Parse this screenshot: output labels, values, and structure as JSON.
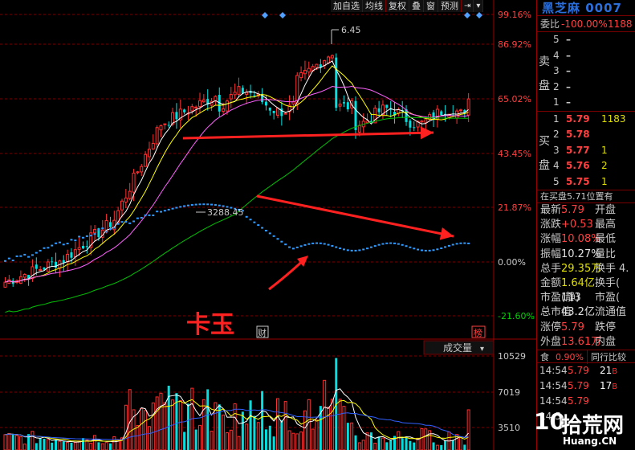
{
  "toolbar": [
    {
      "label": "加自选",
      "name": "add-watchlist-button"
    },
    {
      "label": "均线",
      "name": "moving-average-button"
    },
    {
      "label": "复权",
      "name": "adjust-button"
    },
    {
      "label": "叠",
      "name": "overlay-button"
    },
    {
      "label": "窗",
      "name": "window-button"
    },
    {
      "label": "预测",
      "name": "forecast-button"
    }
  ],
  "toolbar_icons": [
    "exit-icon",
    "dropdown-icon"
  ],
  "chart_data": {
    "type": "candlestick",
    "percent_axis": [
      "99.16%",
      "86.92%",
      "65.02%",
      "43.45%",
      "21.87%",
      "0.00%",
      "-21.60%"
    ],
    "high_marker": "6.45",
    "index_marker": "3288.45",
    "volume_label": "成交量",
    "volume_axis": [
      "10529",
      "7019",
      "3510"
    ],
    "tags": {
      "finance": "财",
      "rank": "榜"
    },
    "annotation_text": "卡玉",
    "colors": {
      "up": "#ff3030",
      "down": "#00e0e0",
      "ma5": "#ffffff",
      "ma10": "#ffff00",
      "ma20": "#ff60ff",
      "ma60": "#00c000",
      "index": "#2f9bff",
      "arrow": "#ff2020"
    }
  },
  "panel": {
    "stock_name": "黑芝麻 0007",
    "wei_label": "委比",
    "wei_bi": "-100.00%",
    "wei_cha": "1188",
    "sell_label": "卖盘",
    "buy_label": "买盘",
    "sell": [
      {
        "level": "5",
        "price": "–",
        "vol": ""
      },
      {
        "level": "4",
        "price": "–",
        "vol": ""
      },
      {
        "level": "3",
        "price": "–",
        "vol": ""
      },
      {
        "level": "2",
        "price": "–",
        "vol": ""
      },
      {
        "level": "1",
        "price": "–",
        "vol": ""
      }
    ],
    "buy": [
      {
        "level": "1",
        "price": "5.79",
        "vol": "1183"
      },
      {
        "level": "2",
        "price": "5.78",
        "vol": ""
      },
      {
        "level": "3",
        "price": "5.77",
        "vol": "1"
      },
      {
        "level": "4",
        "price": "5.76",
        "vol": "2"
      },
      {
        "level": "5",
        "price": "5.75",
        "vol": "1"
      }
    ],
    "position_text": "在买盘5.71位置有",
    "quotes": [
      {
        "l1": "最新",
        "v1": "5.79",
        "c1": "#ff4040",
        "l2": "开盘",
        "v2": ""
      },
      {
        "l1": "涨跌",
        "v1": "+0.53",
        "c1": "#ff4040",
        "l2": "最高",
        "v2": ""
      },
      {
        "l1": "涨幅",
        "v1": "10.08%",
        "c1": "#ff4040",
        "l2": "最低",
        "v2": ""
      },
      {
        "l1": "振幅",
        "v1": "10.27%",
        "c1": "#e0e0e0",
        "l2": "量比",
        "v2": ""
      },
      {
        "l1": "总手",
        "v1": "29.35万",
        "c1": "#e0e000",
        "l2": "换手",
        "v2": "4."
      },
      {
        "l1": "金额",
        "v1": "1.64亿",
        "c1": "#e0e000",
        "l2": "换手(",
        "v2": ""
      },
      {
        "l1": "市盈(静)",
        "v1": "113",
        "c1": "#e0e0e0",
        "l2": "市盈(",
        "v2": ""
      },
      {
        "l1": "总市值",
        "v1": "43.2亿",
        "c1": "#e0e0e0",
        "l2": "流通值",
        "v2": ""
      },
      {
        "l1": "涨停",
        "v1": "5.79",
        "c1": "#ff4040",
        "l2": "跌停",
        "v2": ""
      },
      {
        "l1": "外盘",
        "v1": "13.61万",
        "c1": "#ff4040",
        "l2": "内盘",
        "v2": ""
      }
    ],
    "ticks_head": {
      "industry": "食",
      "change": "0.90%",
      "compare": "同行比较"
    },
    "ticks": [
      {
        "time": "14:54",
        "price": "5.79",
        "vol": "21",
        "dir": "B"
      },
      {
        "time": "14:54",
        "price": "5.79",
        "vol": "17",
        "dir": "B"
      },
      {
        "time": "14:54",
        "price": "5.79",
        "vol": "",
        "dir": ""
      },
      {
        "time": "14:5",
        "price": "",
        "vol": "",
        "dir": ""
      }
    ]
  },
  "watermark": {
    "num": "10",
    "text": "拾荒网",
    "url": "Huang.CN"
  }
}
